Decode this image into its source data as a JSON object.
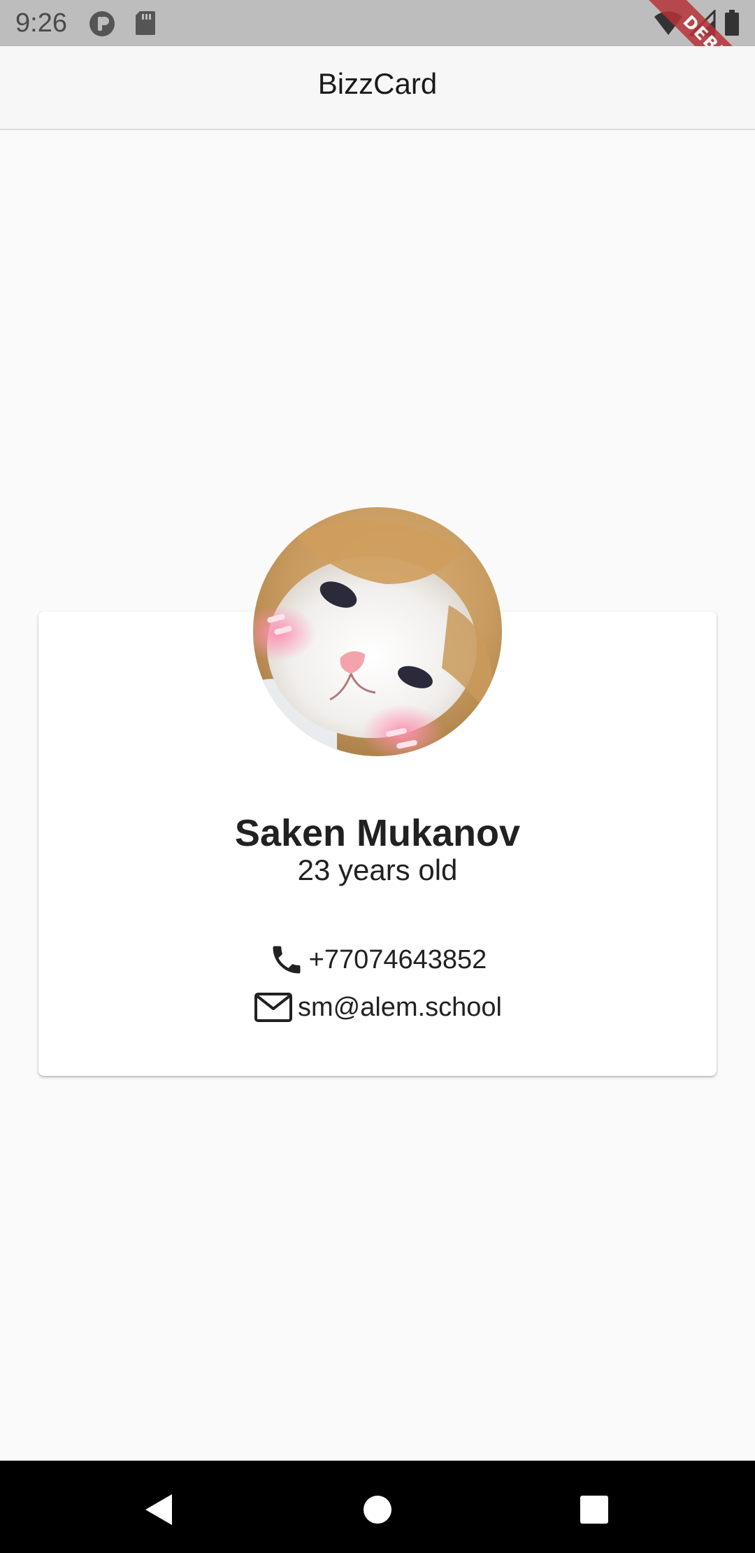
{
  "status_bar": {
    "time": "9:26",
    "icons": [
      "app-notification-icon",
      "sd-card-icon",
      "wifi-icon",
      "cell-signal-icon",
      "battery-icon"
    ]
  },
  "debug_banner": {
    "label": "DEBUG",
    "color": "#b5343a"
  },
  "app_bar": {
    "title": "BizzCard"
  },
  "profile": {
    "avatar": "kitten-photo",
    "name": "Saken Mukanov",
    "age": "23 years old"
  },
  "contacts": {
    "phone": "+77074643852",
    "email": "sm@alem.school"
  },
  "nav_bar": {
    "buttons": [
      "back",
      "home",
      "recents"
    ]
  },
  "colors": {
    "background": "#fafafa",
    "card": "#ffffff",
    "text": "#212121",
    "status_bar": "#bdbdbd"
  }
}
